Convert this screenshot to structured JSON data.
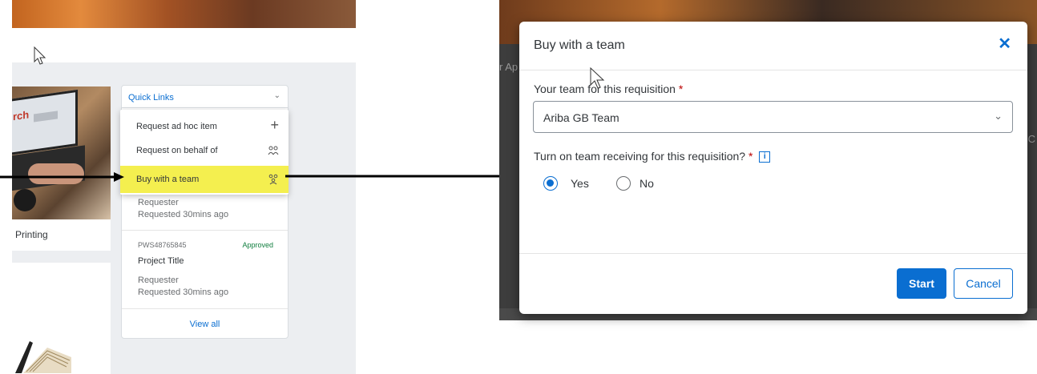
{
  "left": {
    "tile1_label": "Printing",
    "quick_links": {
      "label": "Quick Links",
      "items": [
        {
          "label": "Request ad hoc item",
          "icon": "plus-icon"
        },
        {
          "label": "Request on behalf of",
          "icon": "users-icon"
        },
        {
          "label": "Buy with a team",
          "icon": "team-icon",
          "highlighted": true
        }
      ]
    },
    "request1": {
      "role": "Requester",
      "time": "Requested 30mins ago"
    },
    "request2": {
      "id": "PWS48765845",
      "status": "Approved",
      "title": "Project Title",
      "role": "Requester",
      "time": "Requested 30mins ago"
    },
    "view_all": "View all",
    "highlight_color": "#f4ef4f"
  },
  "background": {
    "left_text": "r Ap",
    "right_text": "C"
  },
  "modal": {
    "title": "Buy with a team",
    "team_label": "Your team for this requisition",
    "team_value": "Ariba GB Team",
    "receiving_label": "Turn on team receiving for this requisition?",
    "required_mark": "*",
    "info_glyph": "i",
    "options": [
      {
        "label": "Yes",
        "selected": true
      },
      {
        "label": "No",
        "selected": false
      }
    ],
    "start_label": "Start",
    "cancel_label": "Cancel",
    "accent_color": "#0a6ed1"
  }
}
